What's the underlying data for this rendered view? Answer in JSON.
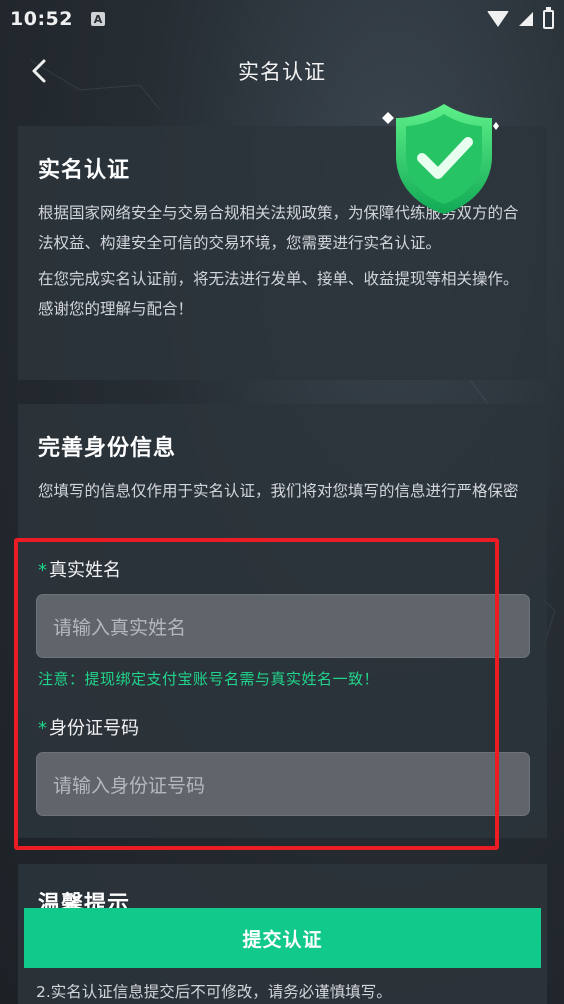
{
  "status_bar": {
    "time": "10:52",
    "notification_icon_letter": "A",
    "icons": [
      "wifi-icon",
      "signal-icon",
      "battery-icon"
    ]
  },
  "nav": {
    "title": "实名认证",
    "back_icon": "chevron-left-icon"
  },
  "verify_card": {
    "title": "实名认证",
    "paragraph1": "根据国家网络安全与交易合规相关法规政策，为保障代练服务双方的合法权益、构建安全可信的交易环境，您需要进行实名认证。",
    "paragraph2": "在您完成实名认证前，将无法进行发单、接单、收益提现等相关操作。感谢您的理解与配合！",
    "badge_icon": "shield-check-icon"
  },
  "info_card": {
    "title": "完善身份信息",
    "description": "您填写的信息仅作用于实名认证，我们将对您填写的信息进行严格保密",
    "name_field": {
      "required_mark": "*",
      "label": "真实姓名",
      "placeholder": "请输入真实姓名"
    },
    "note": "注意：提现绑定支付宝账号名需与真实姓名一致！",
    "id_field": {
      "required_mark": "*",
      "label": "身份证号码",
      "placeholder": "请输入身份证号码"
    }
  },
  "tips_card": {
    "title": "温馨提示",
    "line2": "2.实名认证信息提交后不可修改，请务必谨慎填写。"
  },
  "submit_button": {
    "label": "提交认证"
  },
  "colors": {
    "accent_green": "#11c98a",
    "note_green": "#21d48b",
    "highlight_red": "#ec1c24"
  }
}
